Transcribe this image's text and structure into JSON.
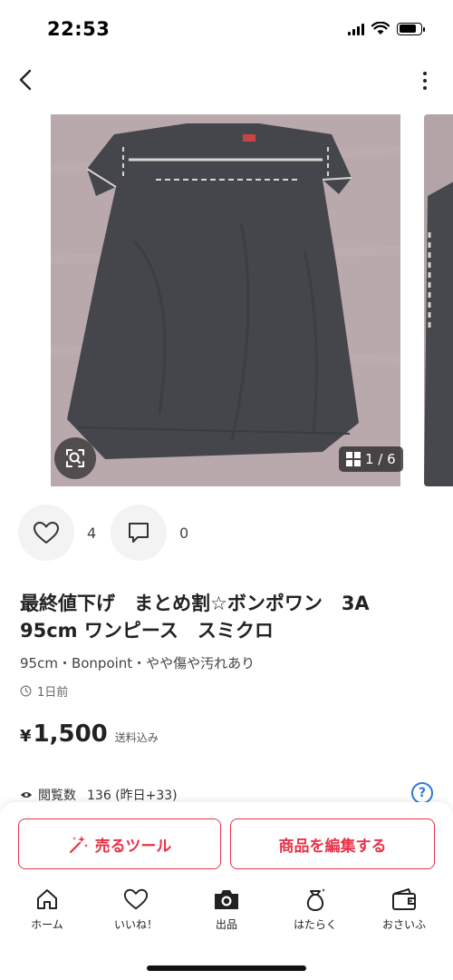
{
  "status_bar": {
    "time": "22:53"
  },
  "header": {
    "back_icon": "chevron-left-icon",
    "more_icon": "more-vertical-icon"
  },
  "gallery": {
    "counter": "1 / 6",
    "counter_icon": "grid-icon",
    "zoom_icon": "scan-zoom-icon"
  },
  "actions": {
    "likes_count": "4",
    "comments_count": "0"
  },
  "item": {
    "title": "最終値下げ　まとめ割☆ボンポワン　3A　95cm ワンピース　スミクロ",
    "meta": "95cm・Bonpoint・やや傷や汚れあり",
    "posted": "1日前",
    "price_symbol": "¥",
    "price": "1,500",
    "shipping_note": "送料込み"
  },
  "stats": {
    "views_label": "閲覧数",
    "views": "136 (昨日+33)"
  },
  "ctas": {
    "sell_tool": "売るツール",
    "edit_item": "商品を編集する"
  },
  "tabbar": {
    "items": [
      {
        "label": "ホーム",
        "icon": "home-icon"
      },
      {
        "label": "いいね！",
        "icon": "heart-icon"
      },
      {
        "label": "出品",
        "icon": "camera-icon"
      },
      {
        "label": "はたらく",
        "icon": "moneybag-icon"
      },
      {
        "label": "おさいふ",
        "icon": "wallet-icon"
      }
    ]
  },
  "colors": {
    "accent": "#e8334a",
    "help": "#2a7ad5",
    "photo_bg": "#b8a8ac",
    "dress": "#42444a"
  }
}
